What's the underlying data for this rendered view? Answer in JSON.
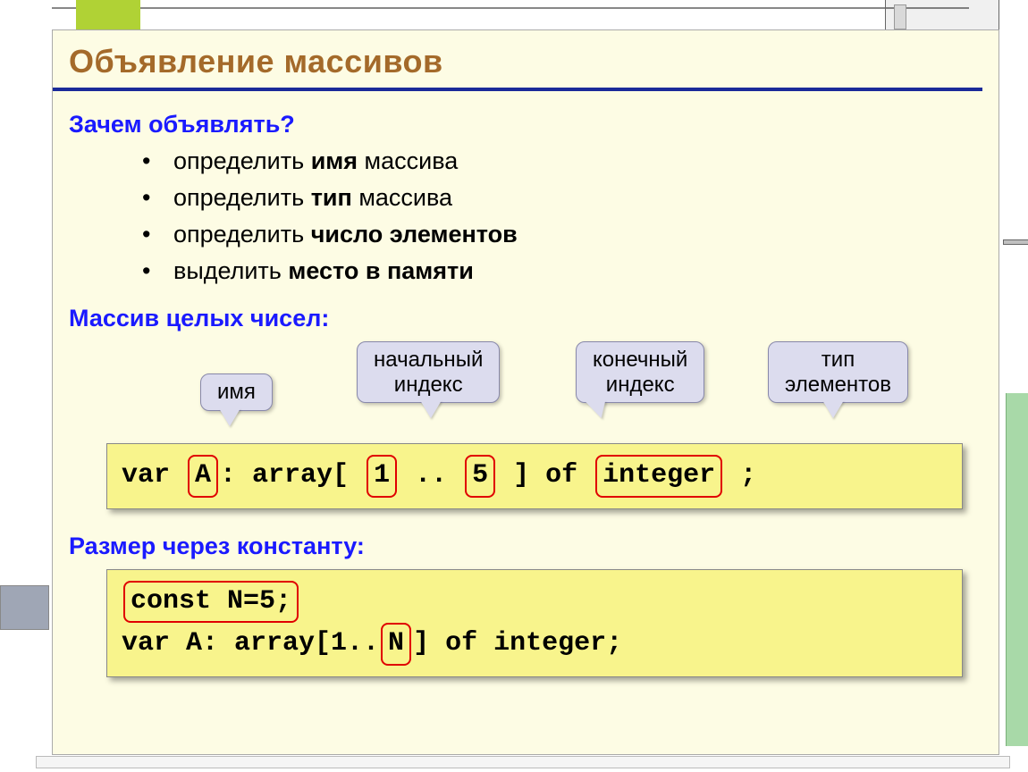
{
  "title": "Объявление массивов",
  "section1": {
    "heading": "Зачем объявлять?",
    "items": [
      {
        "pre": "определить ",
        "b": "имя",
        "post": " массива"
      },
      {
        "pre": "определить ",
        "b": "тип",
        "post": " массива"
      },
      {
        "pre": "определить ",
        "b": "число элементов",
        "post": ""
      },
      {
        "pre": "выделить ",
        "b": "место в памяти",
        "post": ""
      }
    ]
  },
  "section2": {
    "heading": "Массив целых чисел:",
    "callouts": {
      "name": "имя",
      "start_index": "начальный индекс",
      "end_index": "конечный индекс",
      "elem_type": "тип элементов"
    },
    "code": {
      "t1": "var ",
      "t2": "A",
      "t3": ": array[ ",
      "t4": "1",
      "t5": " .. ",
      "t6": "5",
      "t7": " ] of ",
      "t8": "integer",
      "t9": " ;"
    }
  },
  "section3": {
    "heading": "Размер через константу:",
    "code": {
      "line1": "const N=5;",
      "l2a": "var A: array[1..",
      "l2b": "N",
      "l2c": "] of integer;"
    }
  }
}
